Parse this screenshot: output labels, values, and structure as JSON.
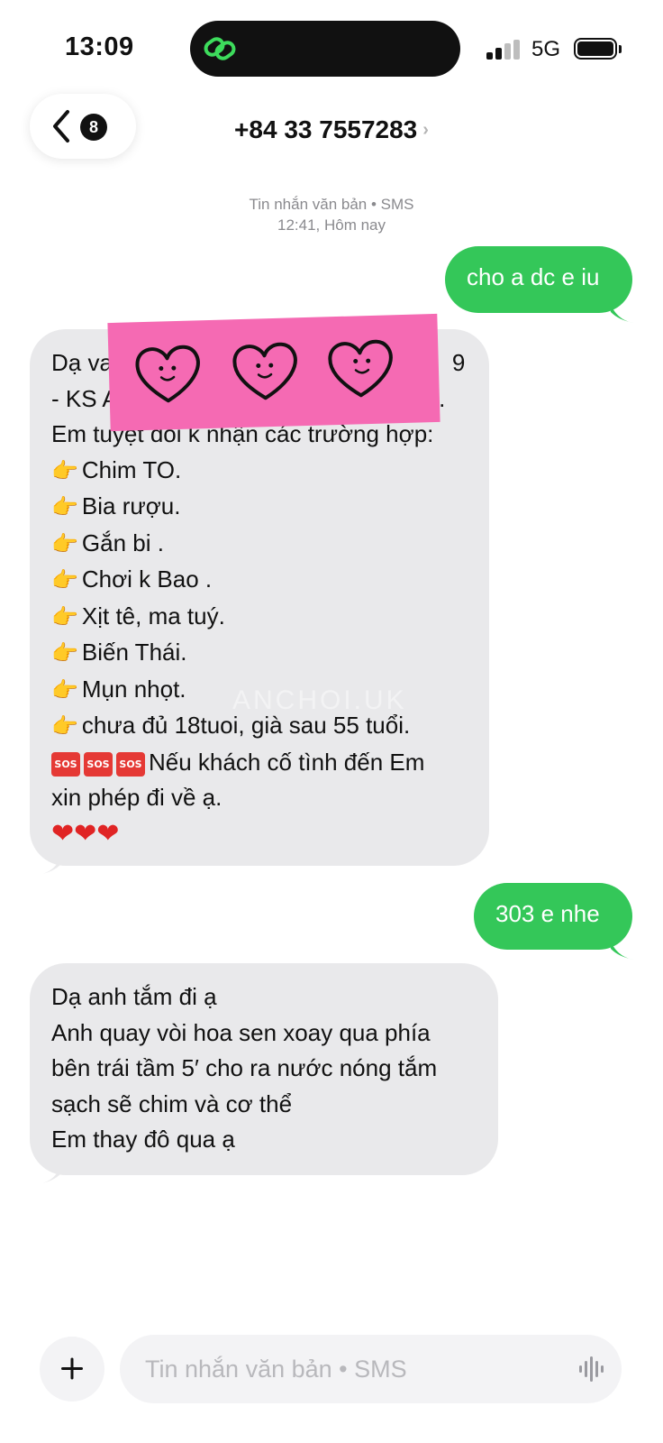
{
  "status_bar": {
    "time": "13:09",
    "network": "5G",
    "signal_bars_active": 2,
    "battery_level": 1.0
  },
  "header": {
    "back_badge": "8",
    "contact": "+84 33 7557283",
    "contact_chevron": "›"
  },
  "thread": {
    "meta_type": "Tin nhắn văn bản • SMS",
    "meta_time": "12:41, Hôm nay"
  },
  "messages": {
    "m1": "cho a dc e iu",
    "m2": {
      "line1_start": "Dạ va",
      "line1_end": "9",
      "line2_start": "- KS A",
      "line2_end": "3.",
      "line3": "Em tuyệt đối k nhận các trường hợp:",
      "items": [
        "Chim TO.",
        "Bia rượu.",
        "Gắn bi .",
        "Chơi k Bao .",
        "Xịt tê, ma tuý.",
        "Biến Thái.",
        "Mụn nhọt.",
        "chưa đủ 18tuoi, già sau 55 tuổi."
      ],
      "sos_label": "SOS",
      "warning_1": "Nếu khách cố tình đến Em",
      "warning_2": "xin phép đi về ạ.",
      "hearts": "❤❤❤",
      "pointer_emoji": "👉"
    },
    "m3": "303 e nhe",
    "m4": [
      "Dạ anh tắm đi ạ",
      "Anh quay vòi hoa sen xoay qua phía",
      "bên trái tầm 5′ cho ra nước nóng tắm",
      "sạch sẽ chim và cơ thể",
      "Em thay đô qua ạ"
    ]
  },
  "watermark": "ANCHOI.UK",
  "composer": {
    "placeholder": "Tin nhắn văn bản • SMS",
    "value": ""
  },
  "colors": {
    "outgoing": "#34c759",
    "incoming": "#e9e9eb",
    "sticker": "#f56ab3",
    "sos": "#e53935",
    "heart": "#e02424"
  },
  "icons": {
    "back": "chevron-left-icon",
    "island": "linked-rings-icon",
    "add": "plus-icon",
    "voice": "waveform-icon"
  }
}
